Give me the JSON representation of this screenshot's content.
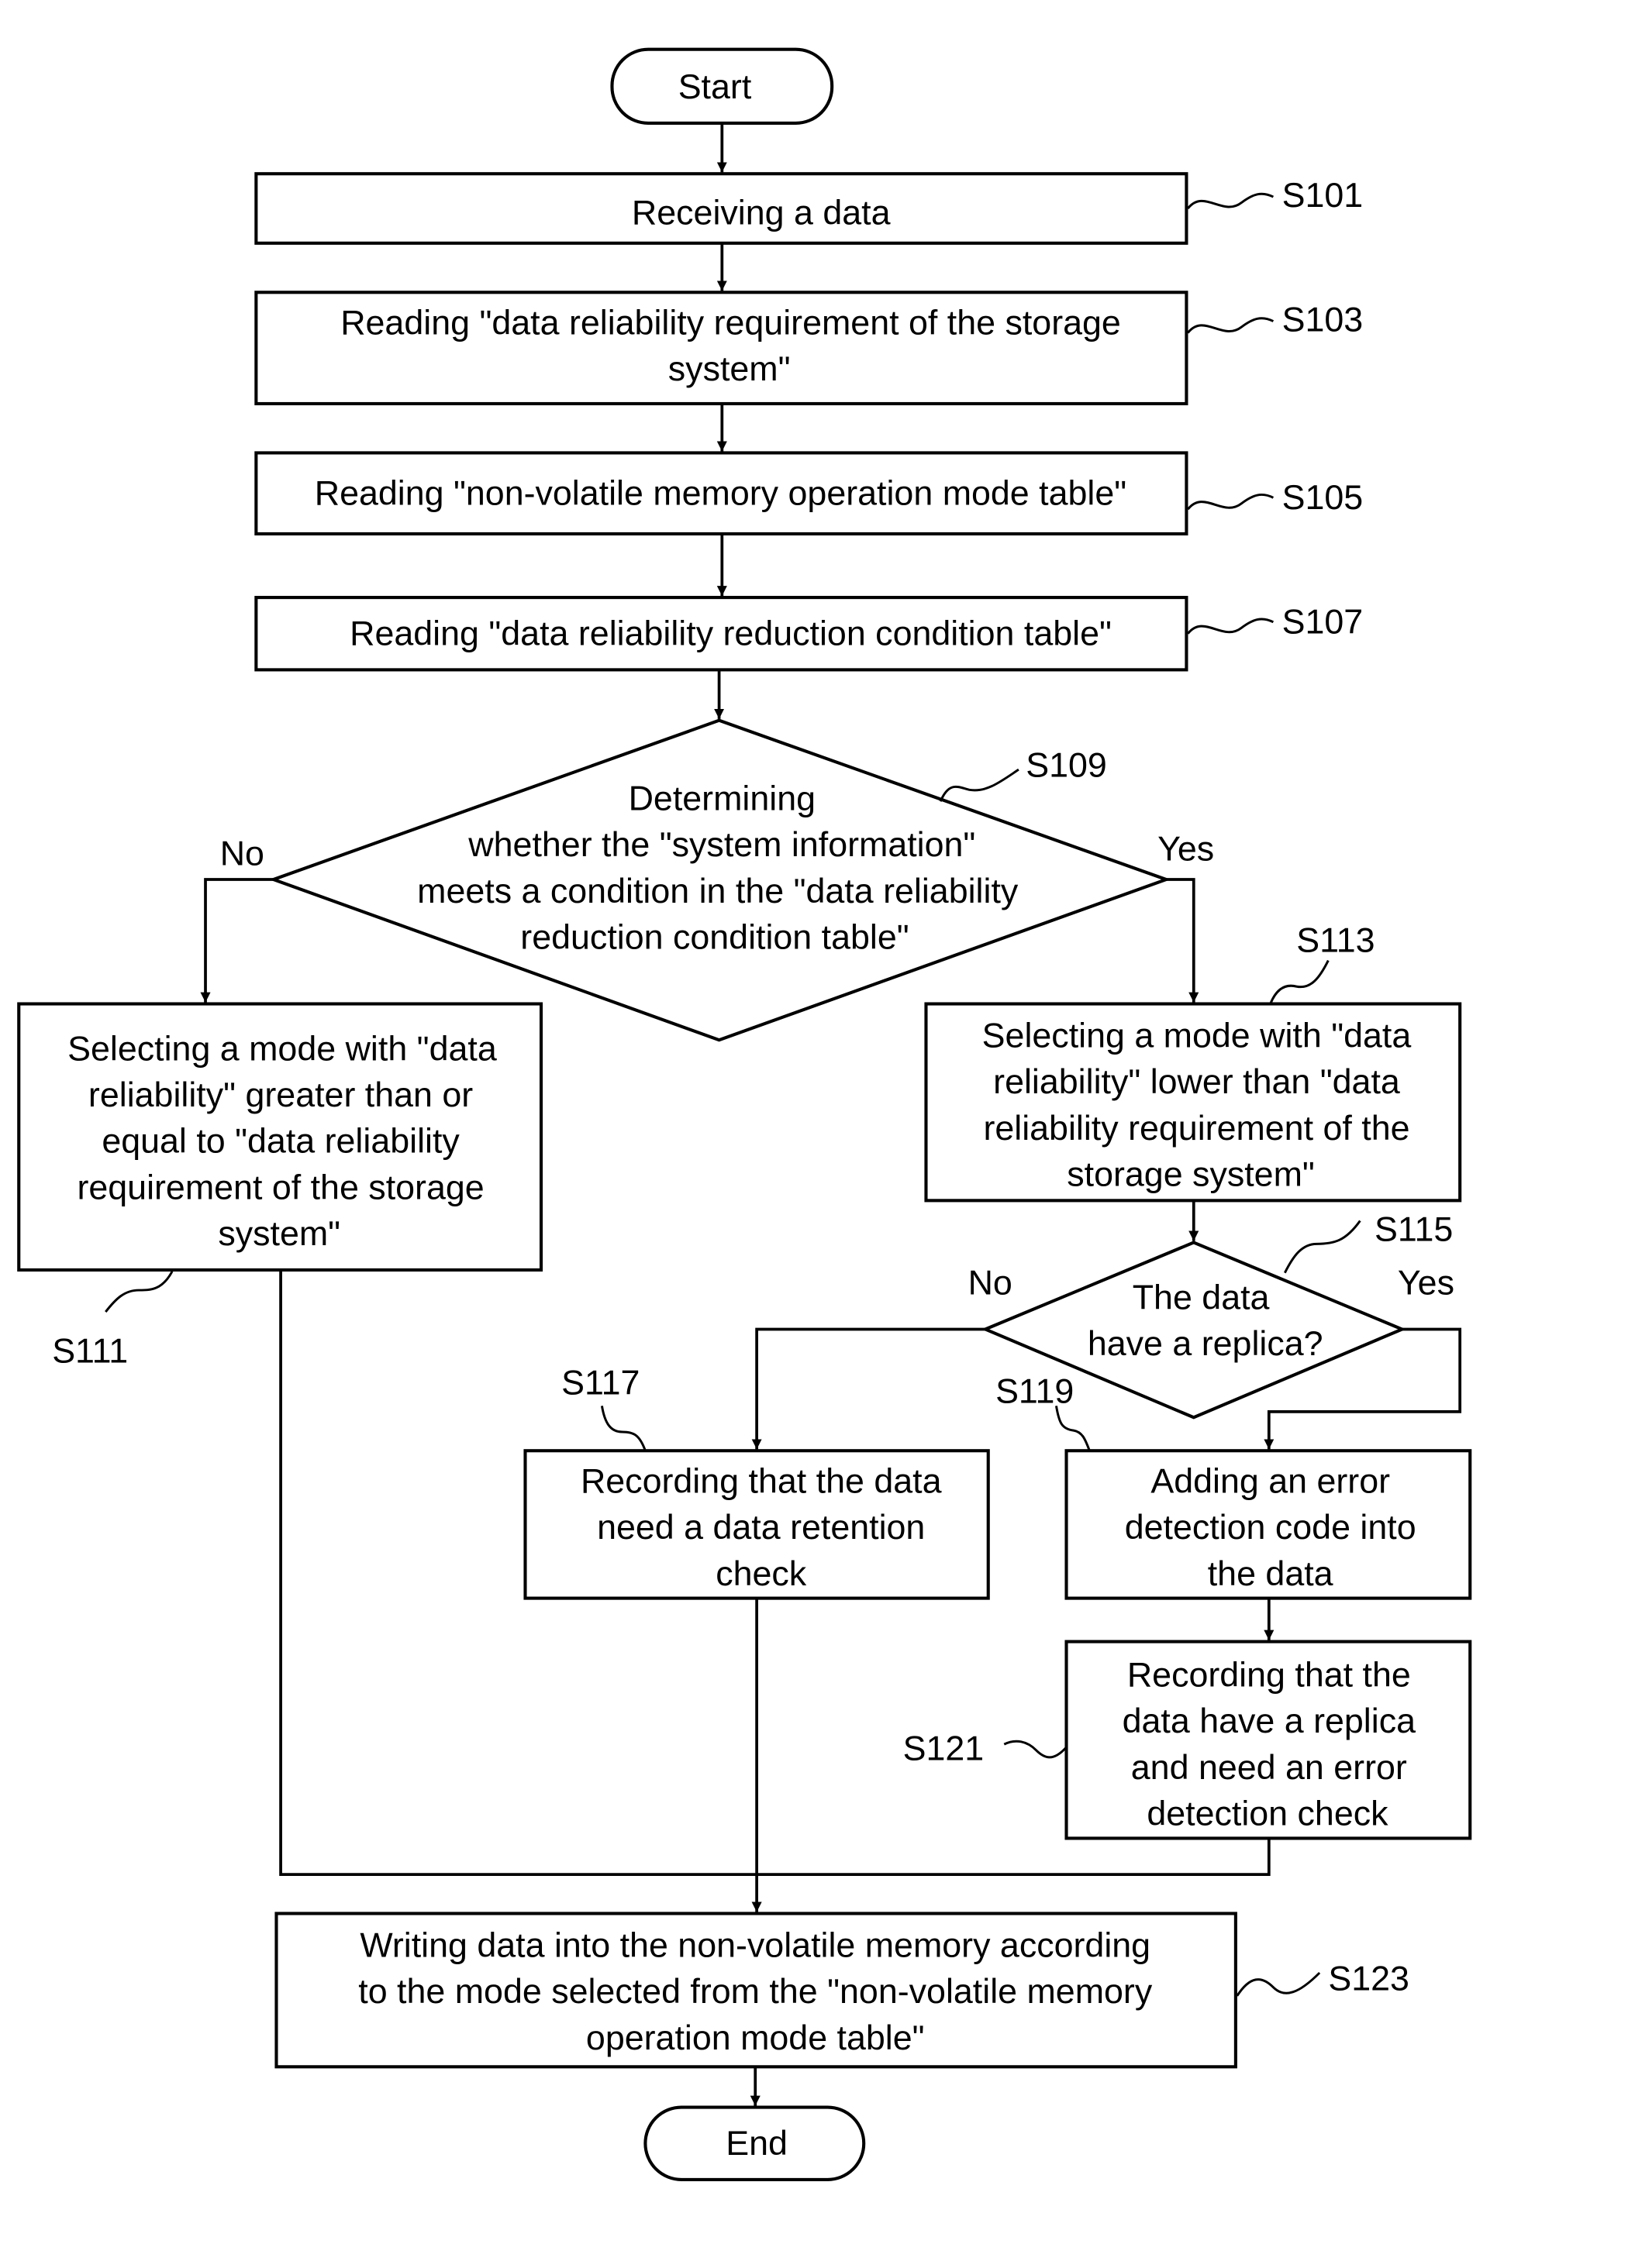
{
  "flowchart": {
    "start": "Start",
    "end": "End",
    "steps": {
      "s101": {
        "id": "S101",
        "lines": [
          "Receiving a data"
        ]
      },
      "s103": {
        "id": "S103",
        "lines": [
          "Reading \"data reliability requirement of the storage",
          "system\""
        ]
      },
      "s105": {
        "id": "S105",
        "lines": [
          "Reading \"non-volatile memory operation mode table\""
        ]
      },
      "s107": {
        "id": "S107",
        "lines": [
          "Reading \"data reliability reduction condition table\""
        ]
      },
      "s109": {
        "id": "S109",
        "lines": [
          "Determining",
          "whether the \"system information\"",
          "meets a condition in the \"data reliability",
          "reduction condition table\""
        ]
      },
      "s111": {
        "id": "S111",
        "lines": [
          "Selecting a mode with \"data",
          "reliability\" greater than or",
          "equal to \"data reliability",
          "requirement of the storage",
          "system\""
        ]
      },
      "s113": {
        "id": "S113",
        "lines": [
          "Selecting a mode with \"data",
          "reliability\" lower than \"data",
          "reliability requirement of the",
          "storage system\""
        ]
      },
      "s115": {
        "id": "S115",
        "lines": [
          "The data",
          "have a replica?"
        ]
      },
      "s117": {
        "id": "S117",
        "lines": [
          "Recording that the data",
          "need a data retention",
          "check"
        ]
      },
      "s119": {
        "id": "S119",
        "lines": [
          "Adding an error",
          "detection code into",
          "the data"
        ]
      },
      "s121": {
        "id": "S121",
        "lines": [
          "Recording that the",
          "data have a replica",
          "and need an error",
          "detection check"
        ]
      },
      "s123": {
        "id": "S123",
        "lines": [
          "Writing data into the non-volatile memory according",
          "to the mode selected  from the \"non-volatile memory",
          "operation mode table\""
        ]
      }
    },
    "branch_labels": {
      "s109_no": "No",
      "s109_yes": "Yes",
      "s115_no": "No",
      "s115_yes": "Yes"
    }
  }
}
